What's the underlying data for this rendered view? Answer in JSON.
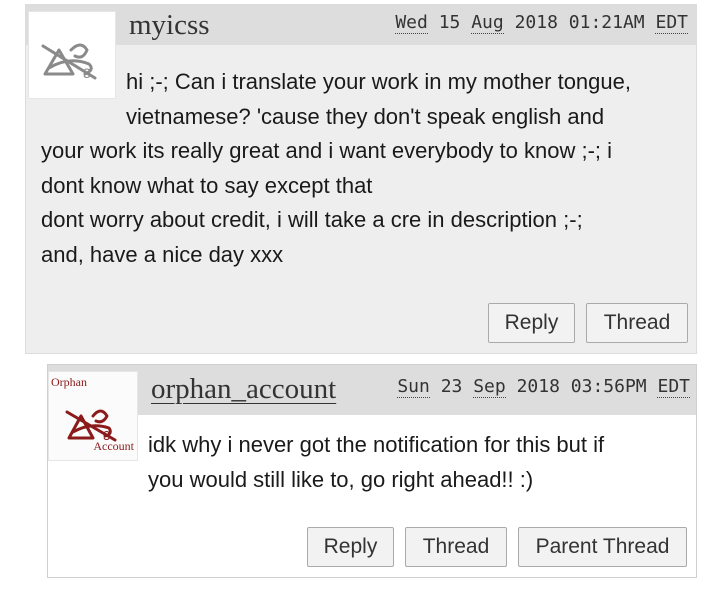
{
  "comments": [
    {
      "username": "myicss",
      "date": {
        "dow": "Wed",
        "day": "15",
        "month": "Aug",
        "year": "2018",
        "time": "01:21AM",
        "tz": "EDT"
      },
      "body_lines": [
        "hi ;-; Can i translate your work in my mother tongue,",
        "vietnamese? 'cause they don't speak english and",
        "your work its really great and i want everybody to know ;-; i",
        "dont know what to say except that",
        "dont worry about credit, i will take a cre in description ;-;",
        "and, have a nice day xxx"
      ],
      "buttons": {
        "reply": "Reply",
        "thread": "Thread"
      },
      "icon": "crossed-ao3-icon"
    },
    {
      "username": "orphan_account",
      "userpic_top_text": "Orphan",
      "userpic_bottom_text": "Account",
      "date": {
        "dow": "Sun",
        "day": "23",
        "month": "Sep",
        "year": "2018",
        "time": "03:56PM",
        "tz": "EDT"
      },
      "body_lines": [
        "idk why i never got the notification for this but if",
        "you would still like to, go right ahead!! :)"
      ],
      "buttons": {
        "reply": "Reply",
        "thread": "Thread",
        "parent_thread": "Parent Thread"
      },
      "icon": "crossed-ao3-red-icon"
    }
  ],
  "colors": {
    "comment_bg": "#eeeeee",
    "header_bg": "#dddddd",
    "orphan_red": "#8b1a1a",
    "icon_gray": "#8a8a8a"
  }
}
